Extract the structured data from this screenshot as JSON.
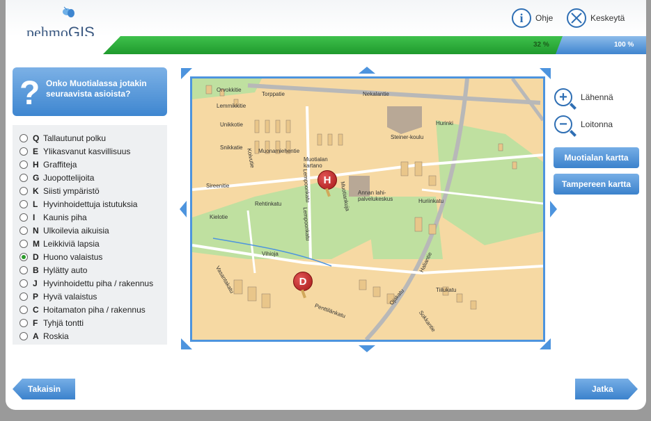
{
  "app": {
    "logo_text": "pehmo",
    "logo_text_gis": "GIS",
    "help_label": "Ohje",
    "cancel_label": "Keskeytä"
  },
  "progress": {
    "current_label": "32 %",
    "total_label": "100 %",
    "value": 0.32
  },
  "question": {
    "icon": "question-mark-icon",
    "text": "Onko Muotialassa jotakin seuraavista asioista?"
  },
  "options": [
    {
      "key": "Q",
      "label": "Tallautunut polku",
      "selected": false
    },
    {
      "key": "E",
      "label": "Ylikasvanut kasvillisuus",
      "selected": false
    },
    {
      "key": "H",
      "label": "Graffiteja",
      "selected": false
    },
    {
      "key": "G",
      "label": "Juopottelijoita",
      "selected": false
    },
    {
      "key": "K",
      "label": "Siisti ympäristö",
      "selected": false
    },
    {
      "key": "L",
      "label": "Hyvinhoidettuja istutuksia",
      "selected": false
    },
    {
      "key": "I",
      "label": "Kaunis piha",
      "selected": false
    },
    {
      "key": "N",
      "label": "Ulkoilevia aikuisia",
      "selected": false
    },
    {
      "key": "M",
      "label": "Leikkiviä lapsia",
      "selected": false
    },
    {
      "key": "D",
      "label": "Huono valaistus",
      "selected": true
    },
    {
      "key": "B",
      "label": "Hylätty auto",
      "selected": false
    },
    {
      "key": "J",
      "label": "Hyvinhoidettu piha / rakennus",
      "selected": false
    },
    {
      "key": "P",
      "label": "Hyvä valaistus",
      "selected": false
    },
    {
      "key": "C",
      "label": "Hoitamaton piha / rakennus",
      "selected": false
    },
    {
      "key": "F",
      "label": "Tyhjä tontti",
      "selected": false
    },
    {
      "key": "A",
      "label": "Roskia",
      "selected": false
    }
  ],
  "map": {
    "street_labels": [
      "Nekalantie",
      "Orvokkitie",
      "Lemmikkitie",
      "Torppatie",
      "Unikkotie",
      "Snikkatie",
      "Muonamiehentie",
      "Muotialan kartano",
      "Steiner-koulu",
      "Hurinki",
      "Sireenitie",
      "Annan lahi-palvelukeskus",
      "Huriinkatu",
      "Kielotie",
      "Rehtinkatu",
      "Muotiankuja",
      "Vihioja",
      "Vasantakatu",
      "Penttilänkatu",
      "Ojakatu",
      "Haliantie",
      "Tiilukatu",
      "Sokkantie",
      "Koivutie",
      "Lempoonkatu",
      "Lempoonkatu"
    ],
    "markers": [
      {
        "letter": "H"
      },
      {
        "letter": "D"
      }
    ]
  },
  "zoom": {
    "in_label": "Lähennä",
    "out_label": "Loitonna"
  },
  "side_buttons": {
    "muotiala_map": "Muotialan kartta",
    "tampere_map": "Tampereen kartta"
  },
  "nav": {
    "back_label": "Takaisin",
    "next_label": "Jatka"
  }
}
